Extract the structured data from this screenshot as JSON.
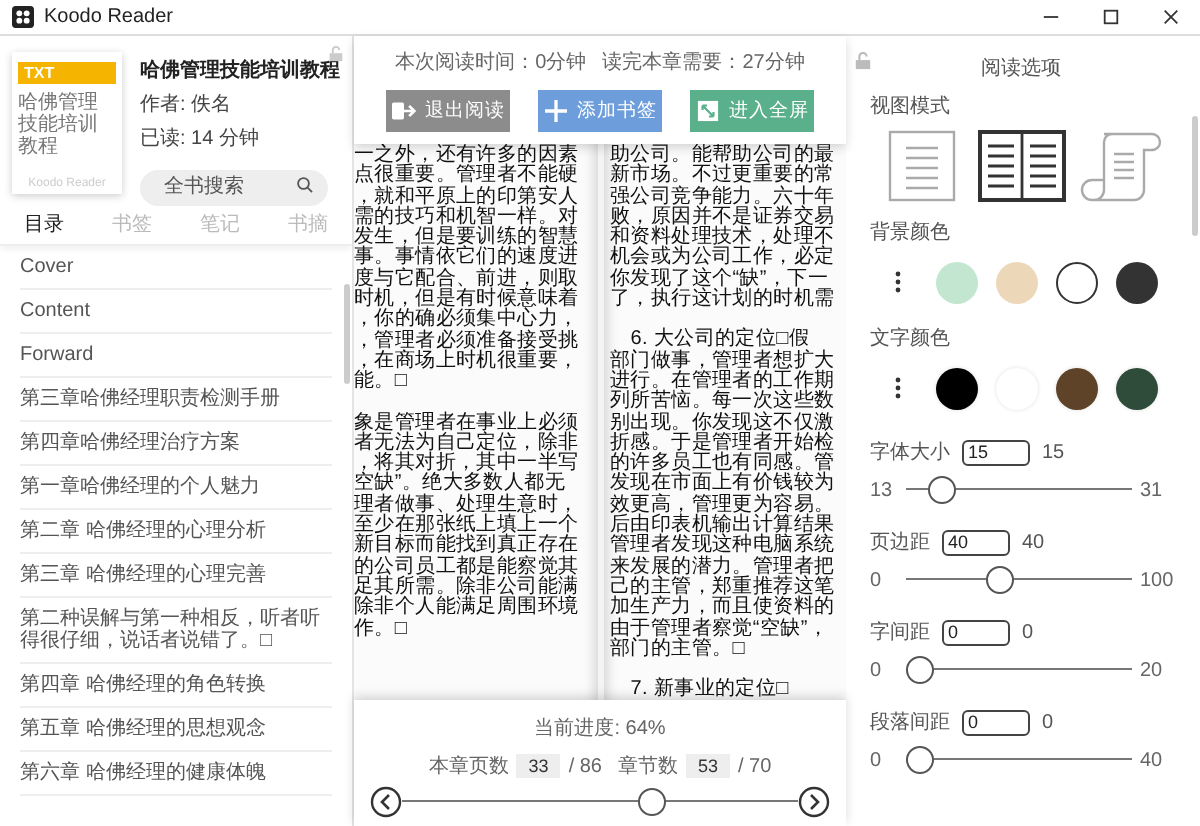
{
  "window": {
    "title": "Koodo Reader"
  },
  "book": {
    "format": "TXT",
    "cover_title": "哈佛管理技能培训教程",
    "cover_brand": "Koodo Reader",
    "title": "哈佛管理技能培训教程",
    "author": "作者: 佚名",
    "read_time": "已读: 14 分钟"
  },
  "search": {
    "placeholder": "全书搜索"
  },
  "sidebar_tabs": [
    {
      "label": "目录",
      "selected": true
    },
    {
      "label": "书签",
      "selected": false
    },
    {
      "label": "笔记",
      "selected": false
    },
    {
      "label": "书摘",
      "selected": false
    }
  ],
  "toc": [
    "Cover",
    "Content",
    "Forward",
    "第三章哈佛经理职责检测手册",
    "第四章哈佛经理治疗方案",
    "第一章哈佛经理的个人魅力",
    "第二章 哈佛经理的心理分析",
    "第三章 哈佛经理的心理完善",
    "第二种误解与第一种相反，听者听得很仔细，说话者说错了。□",
    "第四章 哈佛经理的角色转换",
    "第五章 哈佛经理的思想观念",
    "第六章 哈佛经理的健康体魄"
  ],
  "reader": {
    "reading_time": "本次阅读时间：0分钟",
    "chapter_time": "读完本章需要：27分钟",
    "buttons": [
      {
        "label": "退出阅读",
        "kind": "exit"
      },
      {
        "label": "添加书签",
        "kind": "bookmark"
      },
      {
        "label": "进入全屏",
        "kind": "fullscreen"
      }
    ],
    "left_page": [
      [
        "一之外，还有许多的因素",
        "点很重要。管理者不能硬",
        "，就和平原上的印第安人",
        "需的技巧和机智一样。对",
        "发生，但是要训练的智慧",
        "事。事情依它们的速度进",
        "度与它配合、前进，则取",
        "时机，但是有时候意味着",
        "，你的确必须集中心力，",
        "，管理者必须准备接受挑",
        "，在商场上时机很重要，",
        "能。□"
      ],
      [
        "象是管理者在事业上必须",
        "者无法为自己定位，除非",
        "，将其对折，其中一半写",
        "空缺”。绝大多数人都无",
        "理者做事、处理生意时，",
        "至少在那张纸上填上一个",
        "新目标而能找到真正存在",
        "的公司员工都是能察觉其",
        "足其所需。除非公司能满",
        "除非个人能满足周围环境",
        "作。□"
      ]
    ],
    "right_page": [
      [
        "助公司。能帮助公司的最",
        "新市场。不过更重要的常",
        "强公司竞争能力。六十年",
        "败，原因并不是证券交易",
        "和资料处理技术，处理不",
        "机会或为公司工作，必定",
        "你发现了这个“缺”，下一",
        "了，执行这计划的时机需"
      ],
      [
        "　6. 大公司的定位□假",
        "部门做事，管理者想扩大",
        "进行。在管理者的工作期",
        "列所苦恼。每一次这些数",
        "别出现。你发现这不仅激",
        "折感。于是管理者开始检",
        "的许多员工也有同感。管",
        "发现在市面上有价钱较为",
        "效更高，管理更为容易。",
        "后由印表机输出计算结果",
        "管理者发现这种电脑系统",
        "来发展的潜力。管理者把",
        "己的主管，郑重推荐这笔",
        "加生产力，而且使资料的",
        "由于管理者察觉“空缺”，",
        "部门的主管。□"
      ],
      [
        "　7. 新事业的定位□"
      ]
    ],
    "progress": "当前进度: 64%",
    "page_label": "本章页数",
    "page": "33",
    "page_total": "/ 86",
    "chapter_label": "章节数",
    "chapter": "53",
    "chapter_total": "/ 70",
    "level": 0.64
  },
  "options": {
    "title": "阅读选项",
    "view_mode_label": "视图模式",
    "view_modes": [
      {
        "kind": "single",
        "selected": false
      },
      {
        "kind": "double",
        "selected": true
      },
      {
        "kind": "scroll",
        "selected": false
      }
    ],
    "bg_label": "背景颜色",
    "bg_colors": [
      {
        "color": "#c2e6d0",
        "selected": false
      },
      {
        "color": "#ecd8b8",
        "selected": false
      },
      {
        "color": "#ffffff",
        "selected": true
      },
      {
        "color": "#333333",
        "selected": false
      }
    ],
    "text_label": "文字颜色",
    "text_colors": [
      {
        "color": "#000000"
      },
      {
        "color": "#ffffff"
      },
      {
        "color": "#5e4328"
      },
      {
        "color": "#2f4c3a"
      }
    ],
    "sliders": [
      {
        "label": "字体大小",
        "value": "15",
        "reading": "15",
        "min": "13",
        "max": "31",
        "level": 0.11
      },
      {
        "label": "页边距",
        "value": "40",
        "reading": "40",
        "min": "0",
        "max": "100",
        "level": 0.4
      },
      {
        "label": "字间距",
        "value": "0",
        "reading": "0",
        "min": "0",
        "max": "20",
        "level": 0
      },
      {
        "label": "段落间距",
        "value": "0",
        "reading": "0",
        "min": "0",
        "max": "40",
        "level": 0
      }
    ]
  }
}
